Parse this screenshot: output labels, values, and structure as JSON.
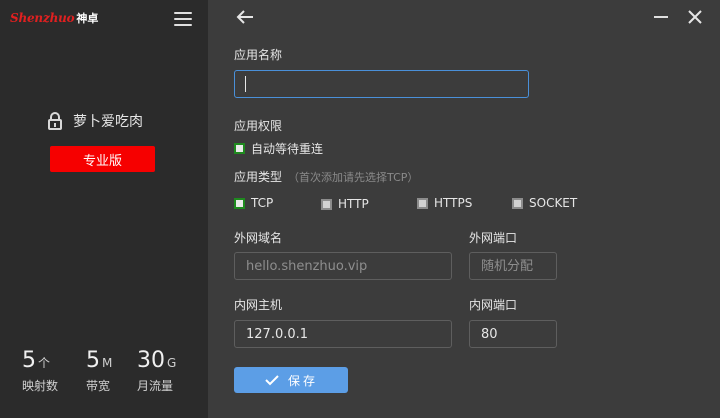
{
  "sidebar": {
    "logo_en": "Shenzhuo",
    "logo_cn": "神卓",
    "username": "萝卜爱吃肉",
    "pro_label": "专业版",
    "stats": [
      {
        "num": "5",
        "unit": "个",
        "label": "映射数"
      },
      {
        "num": "5",
        "unit": "M",
        "label": "带宽"
      },
      {
        "num": "30",
        "unit": "G",
        "label": "月流量"
      }
    ]
  },
  "form": {
    "app_name_label": "应用名称",
    "app_name_value": "",
    "permission_label": "应用权限",
    "auto_reconnect_label": "自动等待重连",
    "auto_reconnect_checked": true,
    "type_label": "应用类型",
    "type_hint": "（首次添加请先选择TCP）",
    "types": [
      {
        "label": "TCP",
        "checked": true
      },
      {
        "label": "HTTP",
        "checked": false
      },
      {
        "label": "HTTPS",
        "checked": false
      },
      {
        "label": "SOCKET",
        "checked": false
      }
    ],
    "external_domain_label": "外网域名",
    "external_domain_placeholder": "hello.shenzhuo.vip",
    "external_port_label": "外网端口",
    "external_port_placeholder": "随机分配",
    "internal_host_label": "内网主机",
    "internal_host_value": "127.0.0.1",
    "internal_port_label": "内网端口",
    "internal_port_value": "80",
    "save_label": "保存"
  },
  "colors": {
    "accent": "#5c9ee6",
    "brand_red": "#f60000",
    "checked_green": "#1f8a1f"
  }
}
